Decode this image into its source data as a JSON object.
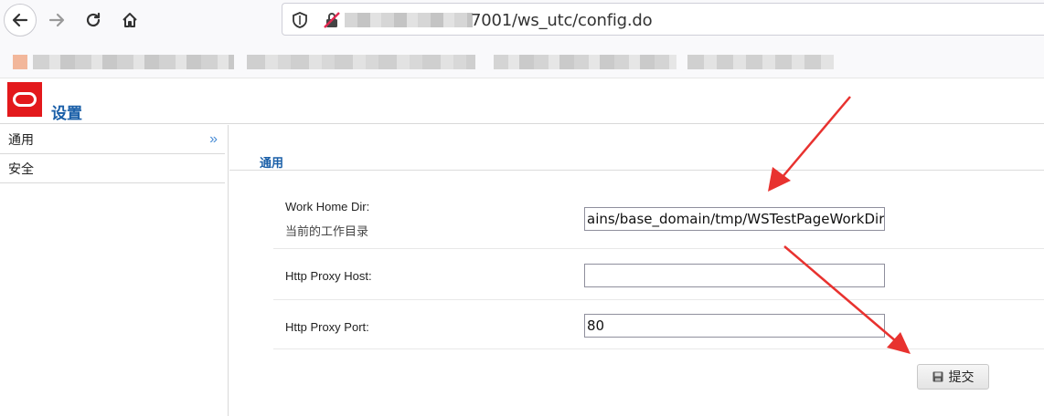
{
  "browser": {
    "url_visible": "7001/ws_utc/config.do",
    "icons": [
      "back-arrow-icon",
      "forward-arrow-icon",
      "reload-icon",
      "home-icon",
      "shield-icon",
      "lock-warning-icon"
    ]
  },
  "app": {
    "title": "设置"
  },
  "sidebar": {
    "items": [
      {
        "label": "通用",
        "active": true
      },
      {
        "label": "安全",
        "active": false
      }
    ]
  },
  "section": {
    "title": "通用"
  },
  "fields": [
    {
      "label": "Work Home Dir:",
      "sublabel": "当前的工作目录",
      "value": "ains/base_domain/tmp/WSTestPageWorkDir"
    },
    {
      "label": "Http Proxy Host:",
      "value": ""
    },
    {
      "label": "Http Proxy Port:",
      "value": "80"
    }
  ],
  "submit": {
    "label": "提交"
  },
  "colors": {
    "accent": "#1a5fa8",
    "logo": "#e3191c",
    "annotation_arrow": "#e8322f"
  }
}
